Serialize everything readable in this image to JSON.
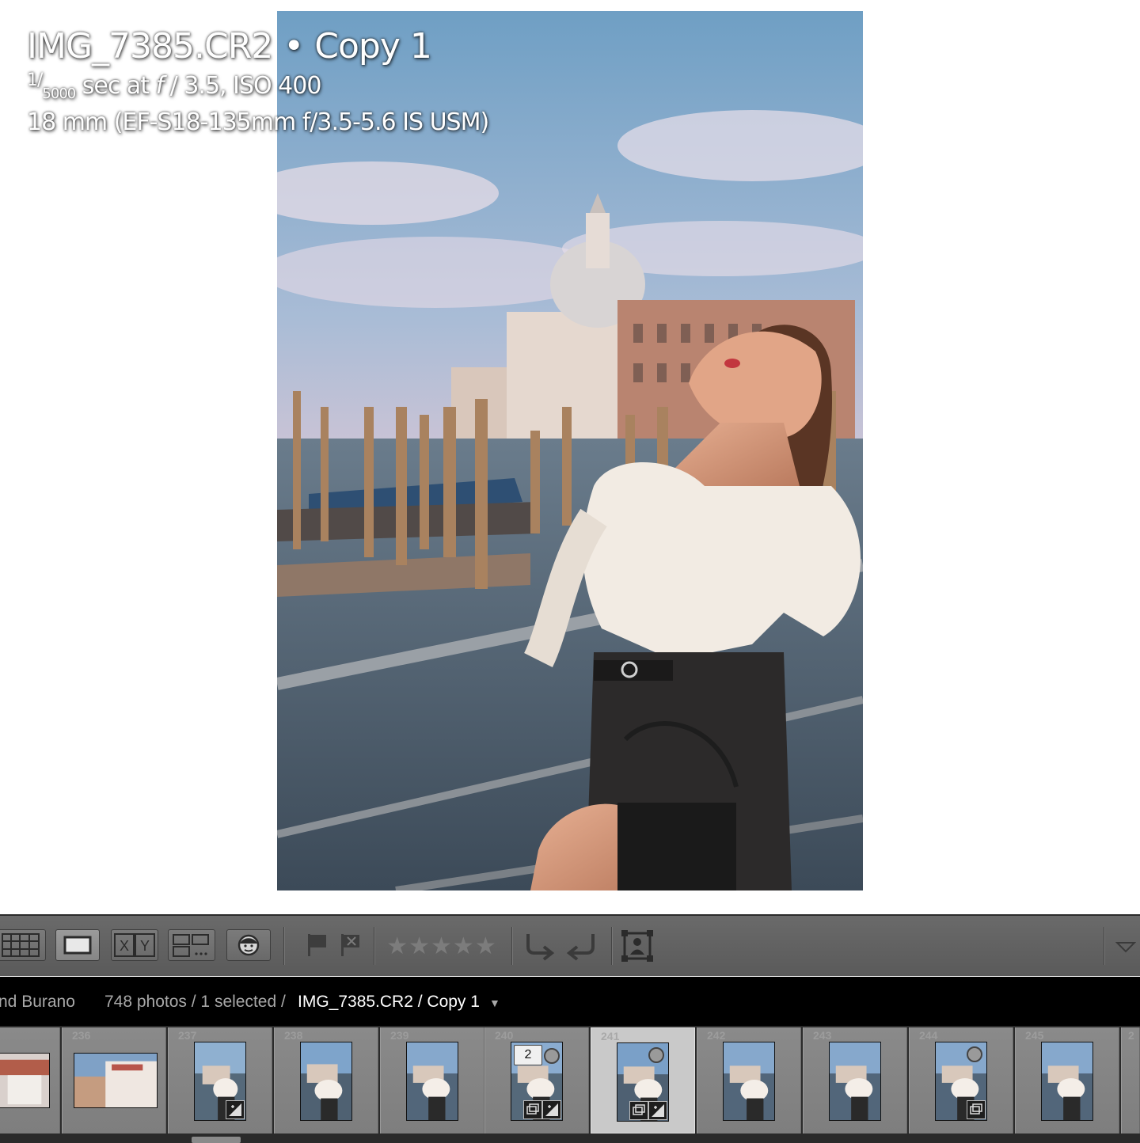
{
  "info": {
    "filename": "IMG_7385.CR2",
    "separator": "•",
    "copy": "Copy 1",
    "shutter_num": "1",
    "shutter_den": "5000",
    "shutter_rest": " sec at ",
    "f_symbol": "f",
    "aperture_iso": " / 3.5, ISO 400",
    "lens": "18 mm (EF-S18-135mm f/3.5-5.6 IS USM)"
  },
  "toolbar": {
    "grid_view_icon": "grid-icon",
    "loupe_view_icon": "loupe-icon",
    "compare_label": "X|Y",
    "survey_view_icon": "survey-icon",
    "people_view_icon": "face-icon",
    "flag_icon": "flag-icon",
    "reject_icon": "reject-flag-icon",
    "stars": "★★★★★",
    "rotate_left_icon": "rotate-left-icon",
    "rotate_right_icon": "rotate-right-icon",
    "crop_icon": "crop-icon",
    "menu_icon": "triangle-down-icon"
  },
  "breadcrumb": {
    "folder": "nd Burano",
    "count": "748 photos / 1 selected /",
    "current": "IMG_7385.CR2 / Copy 1",
    "caret": "▼"
  },
  "filmstrip": {
    "cells": [
      {
        "num": ""
      },
      {
        "num": "236"
      },
      {
        "num": "237"
      },
      {
        "num": "238"
      },
      {
        "num": "239"
      },
      {
        "num": "240",
        "stack": "2"
      },
      {
        "num": "241"
      },
      {
        "num": "242"
      },
      {
        "num": "243"
      },
      {
        "num": "244"
      },
      {
        "num": "245"
      },
      {
        "num": "2"
      }
    ]
  },
  "colors": {
    "toolbar": "#5f5f5f",
    "crumb_bg": "#000000",
    "filmstrip": "#858585",
    "selected_cell": "#c9c9c9"
  }
}
